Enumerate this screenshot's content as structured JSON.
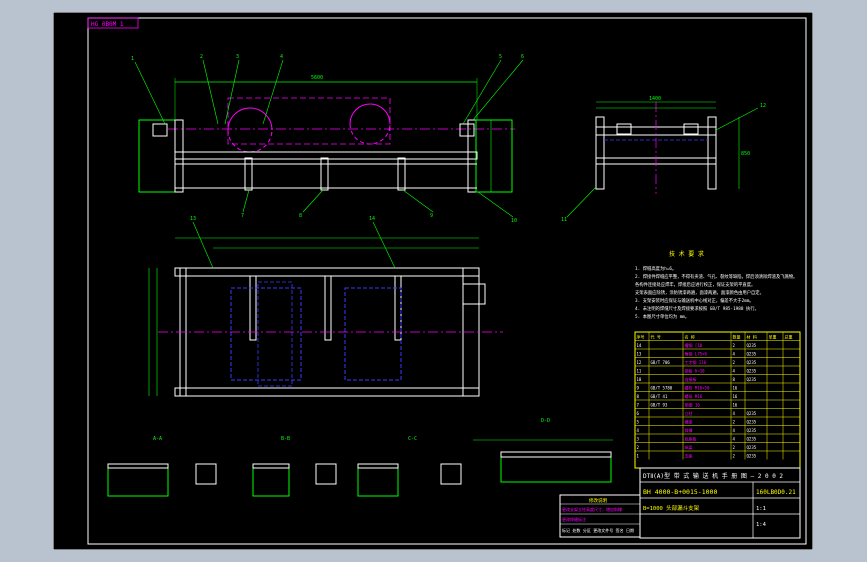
{
  "colors": {
    "background": "#b9c2cf",
    "canvas": "#000000",
    "border": "#ffffff",
    "geometry": "#00ff00",
    "steel": "#ffffff",
    "hidden": "#3a3aff",
    "center": "#ff00ff",
    "dimension": "#00ff00",
    "notes": "#ffff00",
    "table": "#ffff00"
  },
  "drawing": {
    "frame_tag": "HG 0B0M 1",
    "title_line_1": "DTⅡ(A)型   带  式  输  送  机  手  册  图 — 2 0 0 2",
    "title_line_2": "BH 4000-B+0015-1000",
    "drawing_no": "160LB0D0.21",
    "part_name": "B=1000 头部漏斗支架",
    "scale": "1:1",
    "sheet_mark": "1:4",
    "view_labels": [
      "A-A",
      "B-B",
      "C-C",
      "D-D"
    ],
    "dim_total_length": "5600",
    "dim_side_width": "1400",
    "dim_side_height": "850",
    "notes_title": "技  术  要  求",
    "notes": [
      "1. 焊缝高度为h=6。",
      "2. 焊接件焊缝应平整，不得有夹渣、气孔、裂纹等缺陷，焊后须清除焊渣及飞溅物。",
      "   各构件连接处应焊牢，焊接后应进行校正，保证支架的平直度。",
      "   支架表面应除锈，涂防锈漆两遍，面漆两遍，面漆颜色由用户自定。",
      "3. 支架安装时应保证与输送机中心线对正，偏差不大于2mm。",
      "4. 未注明的焊缝尺寸及焊接要求按照 GB/T 985-1988 执行。",
      "5. 本图尺寸单位均为 mm。"
    ]
  },
  "parts_table": {
    "columns": [
      "序号",
      "代 号",
      "名 称",
      "数量",
      "材 料",
      "单重",
      "总重"
    ],
    "rows": [
      [
        "14",
        "",
        "槽钢 [10",
        "2",
        "Q235",
        "",
        ""
      ],
      [
        "13",
        "",
        "角钢 L75×6",
        "4",
        "Q235",
        "",
        ""
      ],
      [
        "12",
        "GB/T 706",
        "工字钢 I16",
        "2",
        "Q235",
        "",
        ""
      ],
      [
        "11",
        "",
        "钢板 δ=10",
        "4",
        "Q235",
        "",
        ""
      ],
      [
        "10",
        "",
        "连接板",
        "8",
        "Q235",
        "",
        ""
      ],
      [
        "9",
        "GB/T 5780",
        "螺栓 M16×50",
        "16",
        "",
        "",
        ""
      ],
      [
        "8",
        "GB/T 41",
        "螺母 M16",
        "16",
        "",
        "",
        ""
      ],
      [
        "7",
        "GB/T 93",
        "垫圈 16",
        "16",
        "",
        "",
        ""
      ],
      [
        "6",
        "",
        "立柱",
        "4",
        "Q235",
        "",
        ""
      ],
      [
        "5",
        "",
        "横梁",
        "2",
        "Q235",
        "",
        ""
      ],
      [
        "4",
        "",
        "斜撑",
        "4",
        "Q235",
        "",
        ""
      ],
      [
        "3",
        "",
        "底座板",
        "4",
        "Q235",
        "",
        ""
      ],
      [
        "2",
        "",
        "纵梁",
        "2",
        "Q235",
        "",
        ""
      ],
      [
        "1",
        "",
        "支座",
        "2",
        "Q235",
        "",
        ""
      ]
    ]
  },
  "revision_block": {
    "header": "修改说明",
    "rows": [
      "更改支架立柱高度尺寸，增加斜撑",
      "更改焊缝标注",
      "标记 处数 分区 更改文件号 签名 日期"
    ]
  },
  "balloons": [
    "1",
    "2",
    "3",
    "4",
    "5",
    "6",
    "7",
    "8",
    "9",
    "10",
    "11",
    "12",
    "13",
    "14"
  ]
}
